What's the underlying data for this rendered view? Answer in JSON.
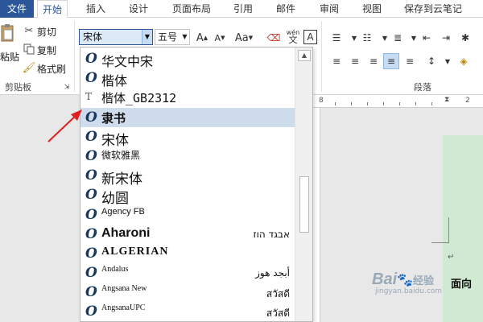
{
  "tabs": [
    "文件",
    "开始",
    "插入",
    "设计",
    "页面布局",
    "引用",
    "邮件",
    "审阅",
    "视图",
    "保存到云笔记"
  ],
  "clipboard": {
    "cut": "剪切",
    "copy": "复制",
    "paste": "粘贴",
    "format_painter": "格式刷",
    "group_label": "剪贴板"
  },
  "font": {
    "name": "宋体",
    "size": "五号",
    "grow": "A",
    "shrink": "A",
    "case": "Aa",
    "phonetic": "wén",
    "border_char": "A"
  },
  "paragraph": {
    "group_label": "段落"
  },
  "ruler": {
    "left_num": "8",
    "right_num": "2"
  },
  "doc": {
    "mark": "↵",
    "fragment": "面向"
  },
  "font_list": [
    {
      "icon": "O",
      "name": "华文中宋",
      "sample": ""
    },
    {
      "icon": "O",
      "name": "楷体",
      "sample": ""
    },
    {
      "icon": "T",
      "name": "楷体_GB2312",
      "sample": ""
    },
    {
      "icon": "O",
      "name": "隶书",
      "sample": ""
    },
    {
      "icon": "O",
      "name": "宋体",
      "sample": ""
    },
    {
      "icon": "O",
      "name": "微软雅黑",
      "sample": ""
    },
    {
      "icon": "O",
      "name": "新宋体",
      "sample": ""
    },
    {
      "icon": "O",
      "name": "幼圆",
      "sample": ""
    },
    {
      "icon": "O",
      "name": "Agency FB",
      "sample": ""
    },
    {
      "icon": "O",
      "name": "Aharoni",
      "sample": "אבגד הוז"
    },
    {
      "icon": "O",
      "name": "ALGERIAN",
      "sample": ""
    },
    {
      "icon": "O",
      "name": "Andalus",
      "sample": "أبجد هوز"
    },
    {
      "icon": "O",
      "name": "Angsana New",
      "sample": "สวัสดี"
    },
    {
      "icon": "O",
      "name": "AngsanaUPC",
      "sample": "สวัสดี"
    }
  ],
  "selected_font_index": 3,
  "watermark": {
    "brand": "Bai",
    "brand2": "经验",
    "url": "jingyan.baidu.com"
  },
  "colors": {
    "accent": "#2b579a",
    "selected_row": "#cfdcec",
    "arrow": "#e02020",
    "page": "#cfe9d2"
  }
}
